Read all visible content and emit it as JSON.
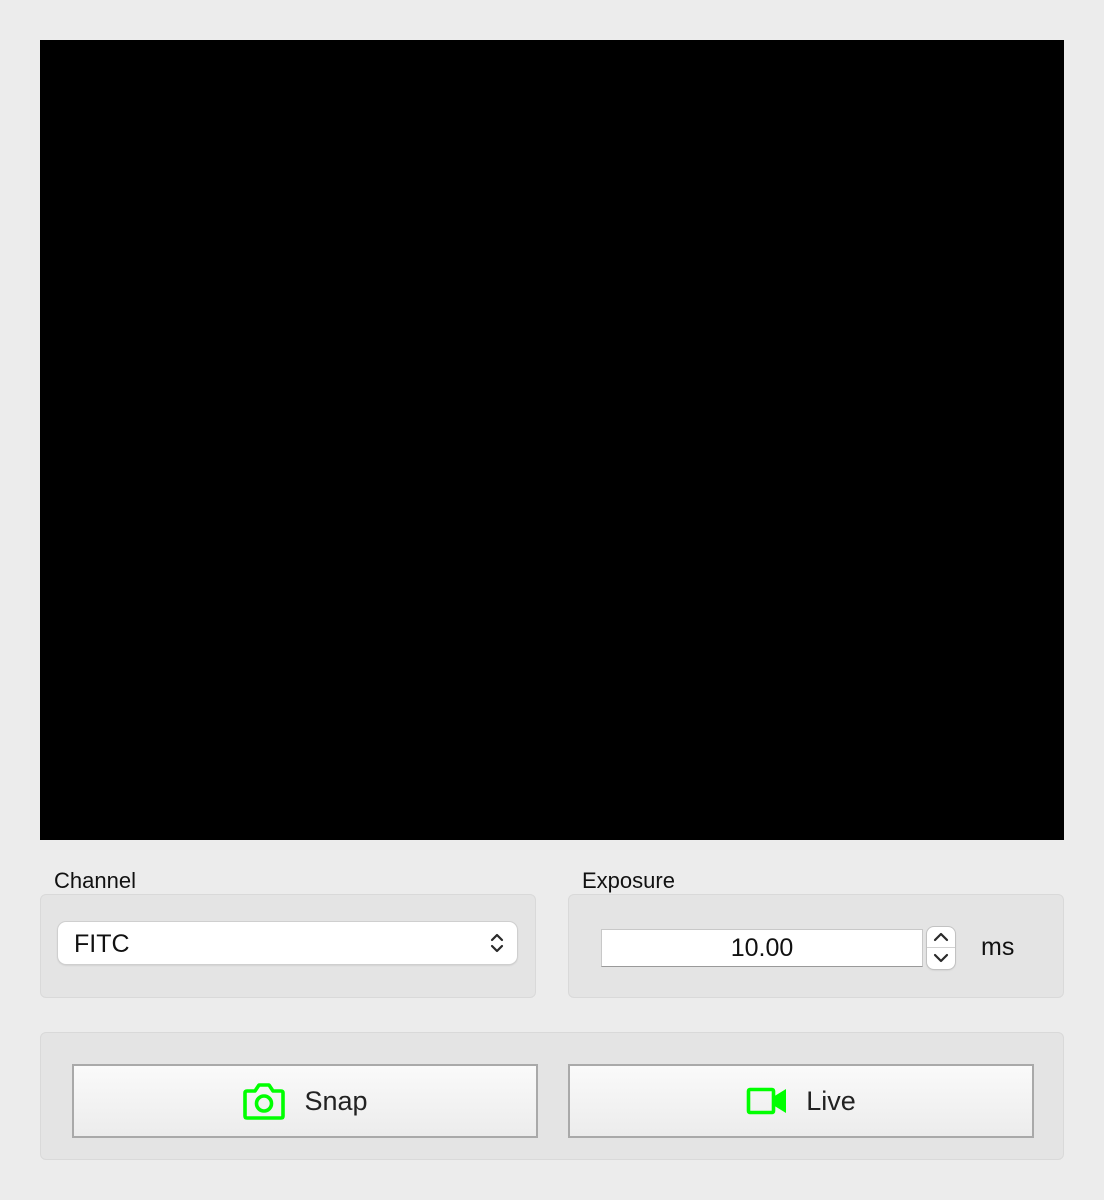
{
  "viewer": {
    "background": "#000000"
  },
  "channel": {
    "label": "Channel",
    "value": "FITC"
  },
  "exposure": {
    "label": "Exposure",
    "value": "10.00",
    "unit": "ms"
  },
  "buttons": {
    "snap_label": "Snap",
    "snap_icon": "camera-icon",
    "live_label": "Live",
    "live_icon": "video-camera-icon",
    "icon_color": "#00ff00"
  }
}
